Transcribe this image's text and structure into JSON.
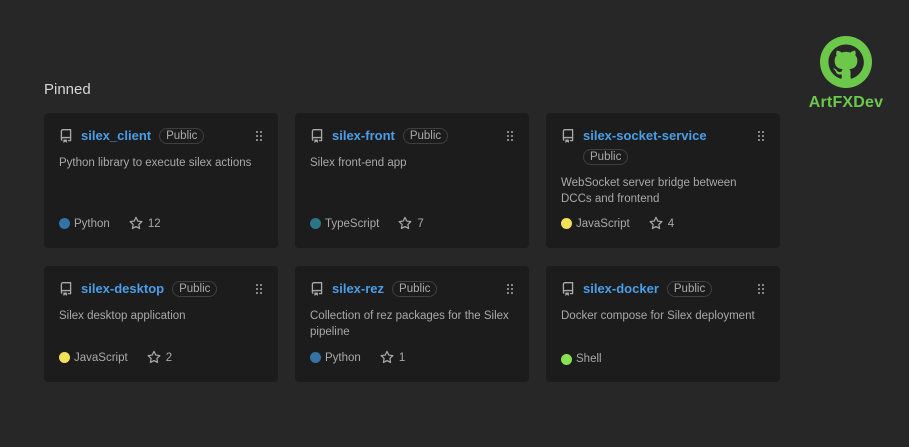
{
  "brand": {
    "name": "ArtFXDev",
    "color": "#6cc84a",
    "icon": "github-octocat-icon"
  },
  "pinned": {
    "title": "Pinned",
    "repos": [
      {
        "name": "silex_client",
        "visibility": "Public",
        "description": "Python library to execute silex actions",
        "language": "Python",
        "language_color": "#3572A5",
        "stars": "12"
      },
      {
        "name": "silex-front",
        "visibility": "Public",
        "description": "Silex front-end app",
        "language": "TypeScript",
        "language_color": "#2b7489",
        "stars": "7"
      },
      {
        "name": "silex-socket-service",
        "visibility": "Public",
        "description": "WebSocket server bridge between DCCs and frontend",
        "language": "JavaScript",
        "language_color": "#f1e05a",
        "stars": "4"
      },
      {
        "name": "silex-desktop",
        "visibility": "Public",
        "description": "Silex desktop application",
        "language": "JavaScript",
        "language_color": "#f1e05a",
        "stars": "2"
      },
      {
        "name": "silex-rez",
        "visibility": "Public",
        "description": "Collection of rez packages for the Silex pipeline",
        "language": "Python",
        "language_color": "#3572A5",
        "stars": "1"
      },
      {
        "name": "silex-docker",
        "visibility": "Public",
        "description": "Docker compose for Silex deployment",
        "language": "Shell",
        "language_color": "#89e051",
        "stars": null
      }
    ]
  }
}
